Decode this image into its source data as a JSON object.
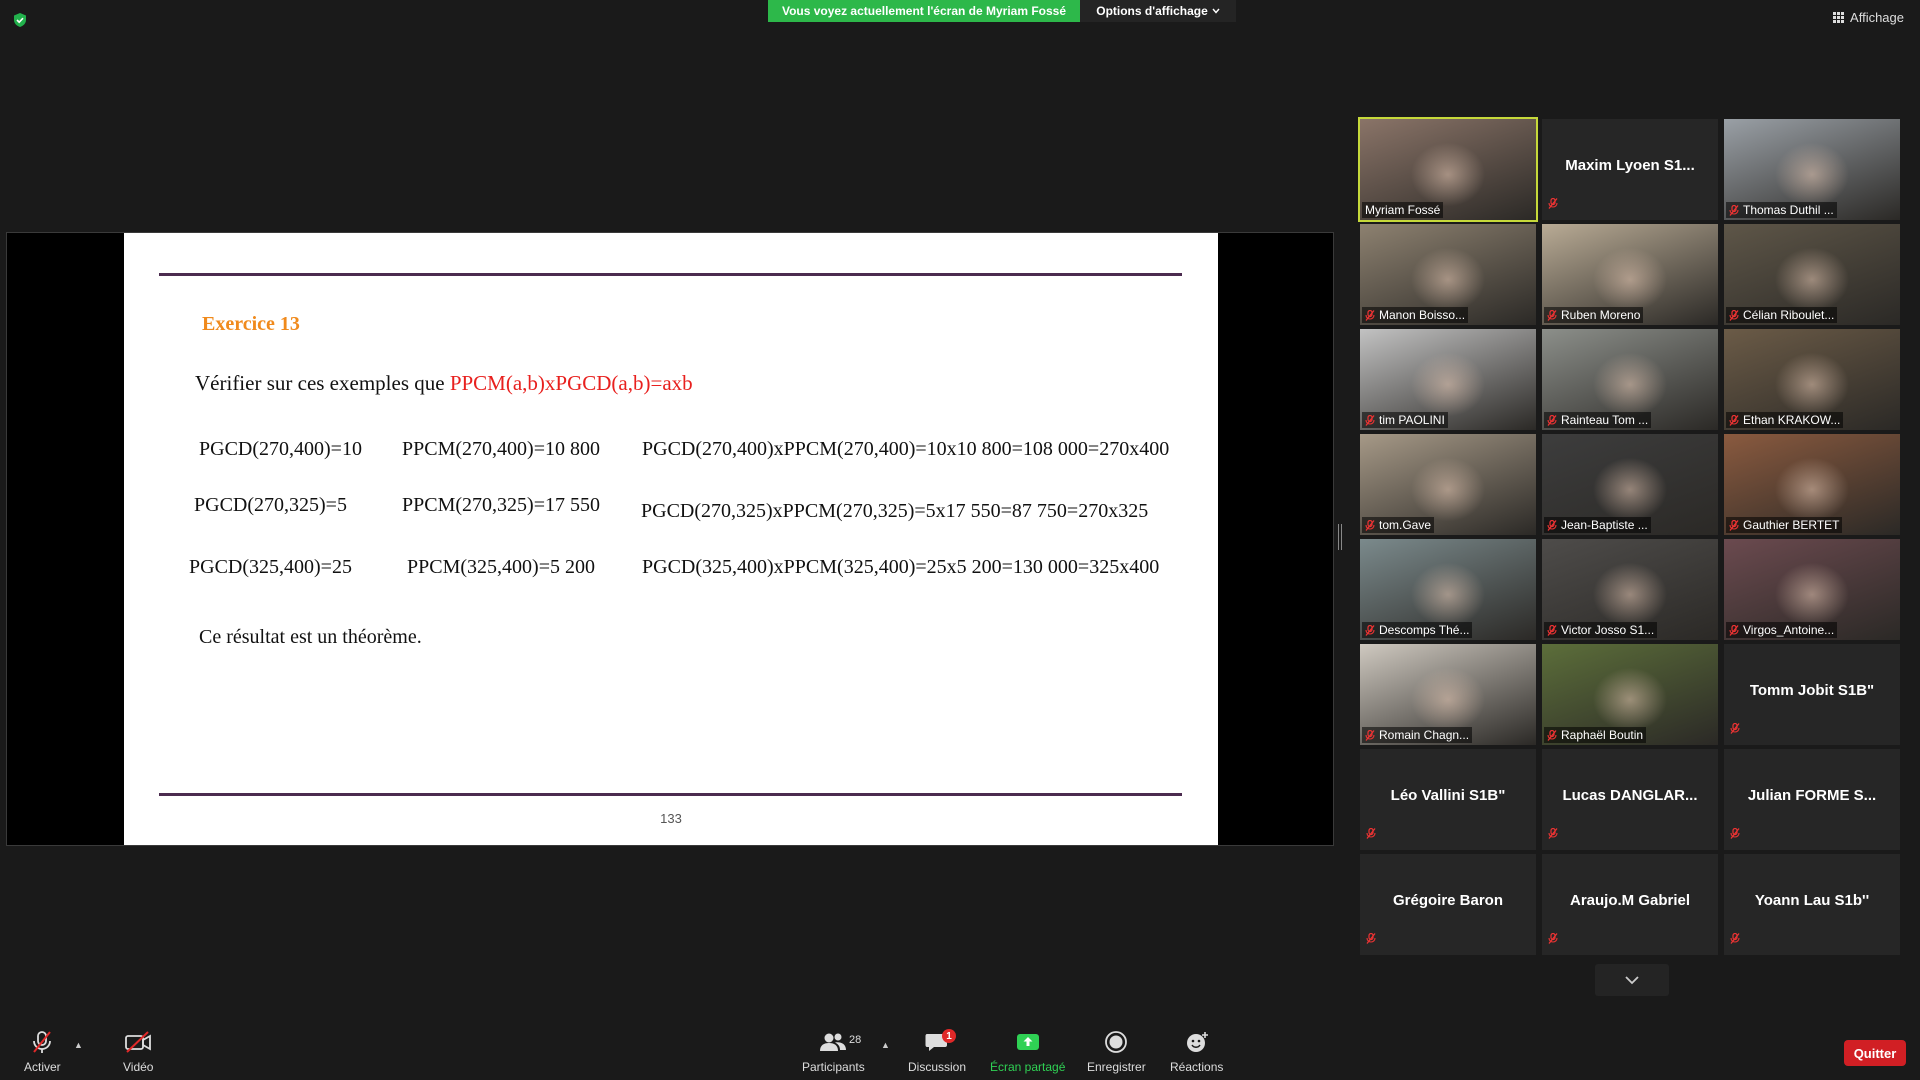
{
  "topbar": {
    "share_banner": "Vous voyez actuellement l'écran de Myriam Fossé",
    "view_options": "Options d'affichage",
    "affichage": "Affichage"
  },
  "slide": {
    "exercise_title": "Exercice 13",
    "instruction_prefix": "Vérifier sur ces exemples que ",
    "instruction_formula": "PPCM(a,b)xPGCD(a,b)=axb",
    "rows": [
      {
        "pgcd": "PGCD(270,400)=10",
        "ppcm": "PPCM(270,400)=10 800",
        "product": "PGCD(270,400)xPPCM(270,400)=10x10 800=108 000=270x400"
      },
      {
        "pgcd": "PGCD(270,325)=5",
        "ppcm": "PPCM(270,325)=17 550",
        "product": "PGCD(270,325)xPPCM(270,325)=5x17 550=87 750=270x325"
      },
      {
        "pgcd": "PGCD(325,400)=25",
        "ppcm": "PPCM(325,400)=5 200",
        "product": "PGCD(325,400)xPPCM(325,400)=25x5 200=130 000=325x400"
      }
    ],
    "conclusion": "Ce résultat est un théorème.",
    "page_number": "133"
  },
  "participants": [
    {
      "name": "Myriam Fossé",
      "video": true,
      "muted": false,
      "active": true,
      "tone": "#8a7468"
    },
    {
      "name": "Maxim  Lyoen  S1...",
      "video": false,
      "muted": true
    },
    {
      "name": "Thomas Duthil ...",
      "video": true,
      "muted": true,
      "tone": "#9aa0a6"
    },
    {
      "name": "Manon Boisso...",
      "video": true,
      "muted": true,
      "tone": "#8d8170"
    },
    {
      "name": "Ruben Moreno",
      "video": true,
      "muted": true,
      "tone": "#b9ab95"
    },
    {
      "name": "Célian Riboulet...",
      "video": true,
      "muted": true,
      "tone": "#5e5648"
    },
    {
      "name": "tim PAOLINI",
      "video": true,
      "muted": true,
      "tone": "#c2c2c2"
    },
    {
      "name": "Rainteau Tom ...",
      "video": true,
      "muted": true,
      "tone": "#8c8f8a"
    },
    {
      "name": "Ethan KRAKOW...",
      "video": true,
      "muted": true,
      "tone": "#6b5b47"
    },
    {
      "name": "tom.Gave",
      "video": true,
      "muted": true,
      "tone": "#a69987"
    },
    {
      "name": "Jean-Baptiste ...",
      "video": true,
      "muted": true,
      "tone": "#3d3d3d"
    },
    {
      "name": "Gauthier BERTET",
      "video": true,
      "muted": true,
      "tone": "#8a5a3f"
    },
    {
      "name": "Descomps Thé...",
      "video": true,
      "muted": true,
      "tone": "#7b8a8c"
    },
    {
      "name": "Victor Josso S1...",
      "video": true,
      "muted": true,
      "tone": "#4e4c4a"
    },
    {
      "name": "Virgos_Antoine...",
      "video": true,
      "muted": true,
      "tone": "#6b4a4f"
    },
    {
      "name": "Romain Chagn...",
      "video": true,
      "muted": true,
      "tone": "#cfc9c0"
    },
    {
      "name": "Raphaël Boutin",
      "video": true,
      "muted": true,
      "tone": "#5c6e3a"
    },
    {
      "name": "Tomm Jobit S1B\"",
      "video": false,
      "muted": true
    },
    {
      "name": "Léo Vallini S1B\"",
      "video": false,
      "muted": true
    },
    {
      "name": "Lucas  DANGLAR...",
      "video": false,
      "muted": true
    },
    {
      "name": "Julian  FORME  S...",
      "video": false,
      "muted": true
    },
    {
      "name": "Grégoire Baron",
      "video": false,
      "muted": true
    },
    {
      "name": "Araujo.M Gabriel",
      "video": false,
      "muted": true
    },
    {
      "name": "Yoann Lau S1b''",
      "video": false,
      "muted": true
    }
  ],
  "toolbar": {
    "mute_label": "Activer",
    "video_label": "Vidéo",
    "participants_label": "Participants",
    "participants_count": "28",
    "chat_label": "Discussion",
    "chat_badge": "1",
    "share_label": "Écran partagé",
    "record_label": "Enregistrer",
    "reactions_label": "Réactions",
    "quit_label": "Quitter"
  },
  "colors": {
    "share_green": "#2db84a",
    "active_speaker": "#c6d93a",
    "quit_red": "#d11f24",
    "exercise_orange": "#f08a1c",
    "formula_red": "#e8201e",
    "rule_purple": "#4b2b4f"
  }
}
